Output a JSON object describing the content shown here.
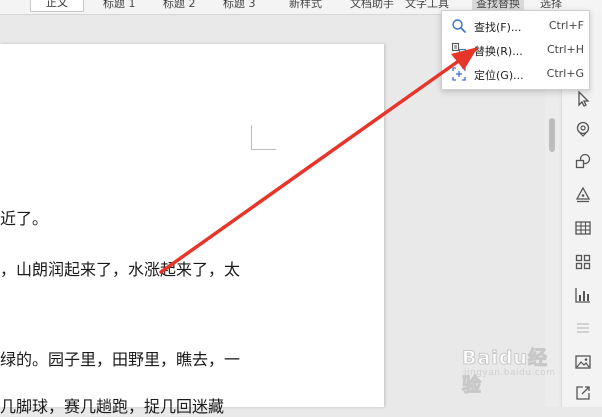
{
  "toolbar": {
    "style_body": "正文",
    "heading1": "标题 1",
    "heading2": "标题 2",
    "heading3": "标题 3",
    "new_style": "新样式",
    "doc_assistant": "文档助手",
    "text_tools": "文字工具",
    "find_replace": "查找替换",
    "select": "选择"
  },
  "document": {
    "lines": [
      "近了。",
      "，山朗润起来了，水涨起来了，太",
      "绿的。园子里，田野里，瞧去，一",
      "几脚球，赛几趟跑，捉几回迷藏"
    ]
  },
  "menu": {
    "items": [
      {
        "label": "查找(F)...",
        "shortcut": "Ctrl+F",
        "icon": "search-icon"
      },
      {
        "label": "替换(R)...",
        "shortcut": "Ctrl+H",
        "icon": "replace-icon"
      },
      {
        "label": "定位(G)...",
        "shortcut": "Ctrl+G",
        "icon": "goto-icon"
      }
    ]
  },
  "sidebar": {
    "icons": [
      "pointer-icon",
      "location-pin-icon",
      "shapes-icon",
      "pen-nib-icon",
      "table-icon",
      "apps-grid-icon",
      "bar-chart-icon",
      "strikethrough-icon",
      "image-icon",
      "share-icon"
    ]
  },
  "watermark": {
    "brand": "Baidu经验",
    "sub": "jingyan.baidu.com"
  },
  "colors": {
    "arrow": "#e8352a",
    "accent": "#2b6fd6"
  }
}
